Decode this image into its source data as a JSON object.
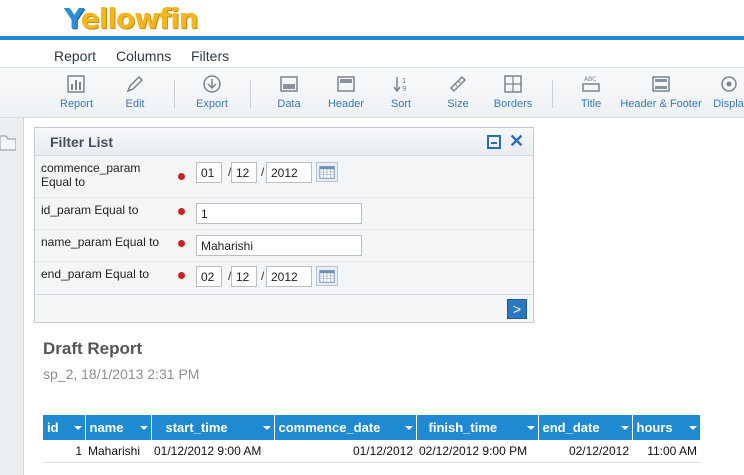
{
  "app": {
    "logo_text_y": "Y",
    "logo_text_rest": "ellowfin"
  },
  "tabs": [
    "Report",
    "Columns",
    "Filters"
  ],
  "toolbar": {
    "report": "Report",
    "edit": "Edit",
    "export": "Export",
    "data": "Data",
    "header": "Header",
    "sort": "Sort",
    "size": "Size",
    "borders": "Borders",
    "title": "Title",
    "header_footer": "Header & Footer",
    "display": "Displa"
  },
  "filter_panel": {
    "title": "Filter List",
    "rows": [
      {
        "label_line1": "commence_param",
        "label_line2": "Equal to",
        "day": "01",
        "month": "12",
        "year": "2012"
      },
      {
        "label": "id_param Equal to",
        "value": "1"
      },
      {
        "label": "name_param Equal to",
        "value": "Maharishi"
      },
      {
        "label": "end_param Equal to",
        "day": "02",
        "month": "12",
        "year": "2012"
      }
    ],
    "slash": "/"
  },
  "report": {
    "title": "Draft Report",
    "subtitle": "sp_2, 18/1/2013 2:31 PM",
    "columns": [
      "id",
      "name",
      "start_time",
      "commence_date",
      "finish_time",
      "end_date",
      "hours"
    ],
    "rows": [
      [
        "1",
        "Maharishi",
        "01/12/2012 9:00 AM",
        "01/12/2012",
        "02/12/2012 9:00 PM",
        "02/12/2012",
        "11:00 AM"
      ]
    ]
  },
  "colors": {
    "accent": "#1f8ad1",
    "required_dot": "#cc2020",
    "logo_yellow": "#f3b61f"
  }
}
